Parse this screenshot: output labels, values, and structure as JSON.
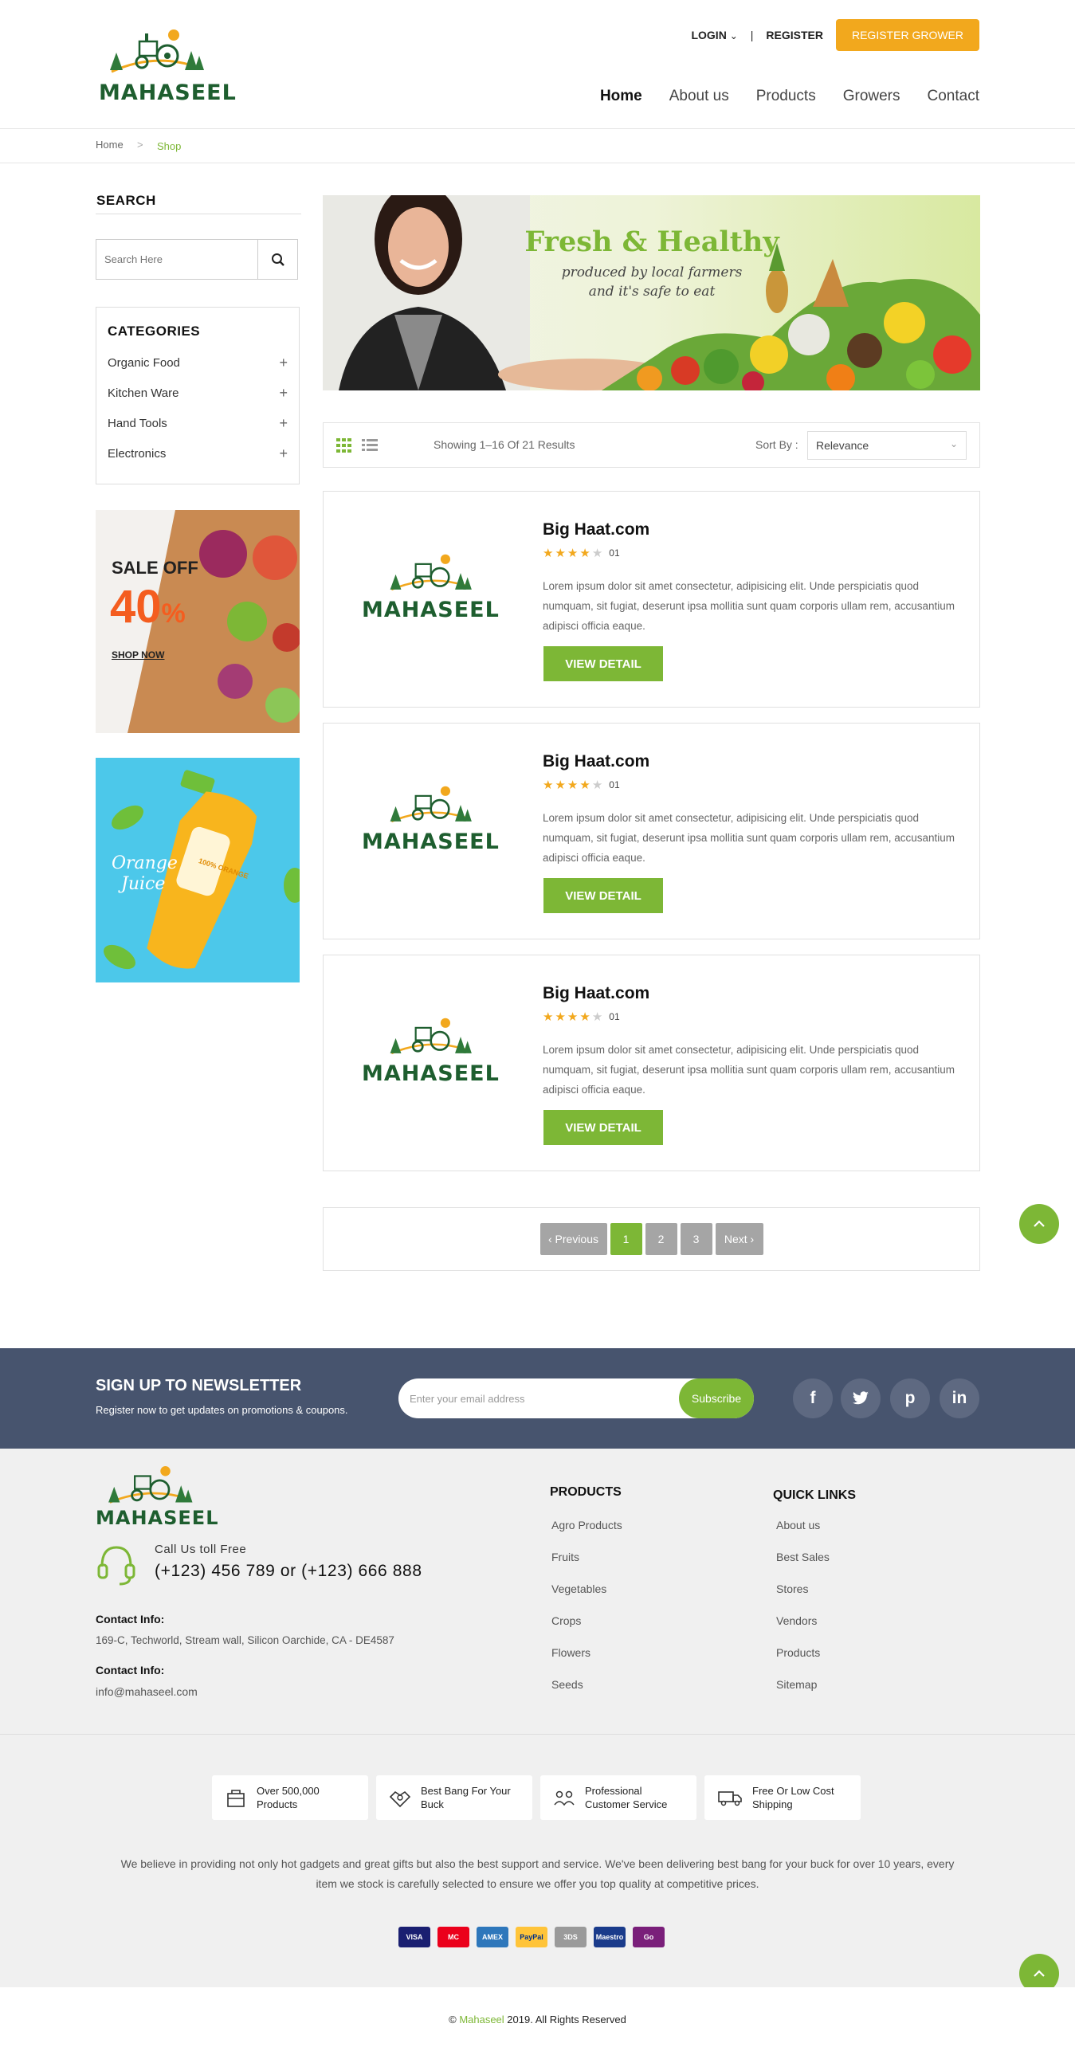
{
  "brand": {
    "name": "MAHASEEL",
    "accent": "#7db736",
    "orange": "#f2a81d",
    "dark_green": "#1e5e2f"
  },
  "header": {
    "login": "LOGIN",
    "separator": "|",
    "register": "REGISTER",
    "register_grower": "REGISTER GROWER",
    "nav": [
      "Home",
      "About us",
      "Products",
      "Growers",
      "Contact"
    ]
  },
  "breadcrumb": {
    "home": "Home",
    "sep": ">",
    "current": "Shop"
  },
  "sidebar": {
    "search_title": "SEARCH",
    "search_placeholder": "Search Here",
    "categories_title": "CATEGORIES",
    "categories": [
      {
        "label": "Organic Food",
        "icon": "+"
      },
      {
        "label": "Kitchen Ware",
        "icon": "+"
      },
      {
        "label": "Hand Tools",
        "icon": "+"
      },
      {
        "label": "Electronics",
        "icon": "+"
      }
    ],
    "sale_banner": {
      "line1": "SALE OFF",
      "percent": "40",
      "pct_sign": "%",
      "cta": "SHOP NOW"
    },
    "juice_banner": {
      "line1": "Orange",
      "line2": "Juice",
      "label": "100% ORANGE"
    }
  },
  "hero": {
    "title": "Fresh & Healthy",
    "sub1": "produced by local farmers",
    "sub2": "and it's safe to eat"
  },
  "toolbar": {
    "results": "Showing 1–16 Of 21 Results",
    "sort_label": "Sort By :",
    "sort_value": "Relevance"
  },
  "listings": [
    {
      "title": "Big Haat.com",
      "rating": 4,
      "rating_count": "01",
      "desc": "Lorem ipsum dolor sit amet consectetur, adipisicing elit. Unde perspiciatis quod numquam, sit fugiat, deserunt ipsa mollitia sunt quam corporis ullam rem, accusantium adipisci officia eaque.",
      "button": "VIEW DETAIL"
    },
    {
      "title": "Big Haat.com",
      "rating": 4,
      "rating_count": "01",
      "desc": "Lorem ipsum dolor sit amet consectetur, adipisicing elit. Unde perspiciatis quod numquam, sit fugiat, deserunt ipsa mollitia sunt quam corporis ullam rem, accusantium adipisci officia eaque.",
      "button": "VIEW DETAIL"
    },
    {
      "title": "Big Haat.com",
      "rating": 4,
      "rating_count": "01",
      "desc": "Lorem ipsum dolor sit amet consectetur, adipisicing elit. Unde perspiciatis quod numquam, sit fugiat, deserunt ipsa mollitia sunt quam corporis ullam rem, accusantium adipisci officia eaque.",
      "button": "VIEW DETAIL"
    }
  ],
  "pagination": {
    "prev": "‹ Previous",
    "pages": [
      "1",
      "2",
      "3"
    ],
    "current": "1",
    "next": "Next ›"
  },
  "newsletter": {
    "title": "SIGN UP TO NEWSLETTER",
    "subtitle": "Register now to get updates on promotions & coupons.",
    "placeholder": "Enter your email address",
    "button": "Subscribe",
    "social": [
      {
        "name": "facebook-icon",
        "glyph": "f"
      },
      {
        "name": "twitter-icon",
        "glyph": "t"
      },
      {
        "name": "pinterest-icon",
        "glyph": "p"
      },
      {
        "name": "linkedin-icon",
        "glyph": "in"
      }
    ]
  },
  "footer": {
    "call_label": "Call Us toll Free",
    "phone": "(+123) 456 789 or (+123) 666 888",
    "contact1_label": "Contact Info:",
    "address": "169-C, Techworld, Stream wall, Silicon Oarchide, CA - DE4587",
    "contact2_label": "Contact Info:",
    "email": "info@mahaseel.com",
    "products_title": "PRODUCTS",
    "products": [
      "Agro Products",
      "Fruits",
      "Vegetables",
      "Crops",
      "Flowers",
      "Seeds"
    ],
    "quick_title": "QUICK LINKS",
    "quick": [
      "About us",
      "Best Sales",
      "Stores",
      "Vendors",
      "Products",
      "Sitemap"
    ],
    "features": [
      {
        "l1": "Over 500,000",
        "l2": "Products"
      },
      {
        "l1": "Best Bang For Your",
        "l2": "Buck"
      },
      {
        "l1": "Professional",
        "l2": "Customer Service"
      },
      {
        "l1": "Free Or Low Cost",
        "l2": "Shipping"
      }
    ],
    "about_line1": "We believe in providing not only hot gadgets and great gifts but also the best support and service. We've been delivering best bang for your buck for over 10 years, every",
    "about_line2": "item we stock is carefully selected to ensure we offer you top quality at competitive prices.",
    "payments": [
      {
        "name": "visa-icon",
        "text": "VISA",
        "color": "#1a1f71"
      },
      {
        "name": "mastercard-icon",
        "text": "MC",
        "color": "#eb001b"
      },
      {
        "name": "amex-icon",
        "text": "AMEX",
        "color": "#2e77bb"
      },
      {
        "name": "paypal-icon",
        "text": "PayPal",
        "color": "#ffc439"
      },
      {
        "name": "3dsecure-icon",
        "text": "3DS",
        "color": "#9a9a9a"
      },
      {
        "name": "maestro-icon",
        "text": "Maestro",
        "color": "#1a3b8b"
      },
      {
        "name": "discover-icon",
        "text": "Go",
        "color": "#7a1f7a"
      }
    ],
    "copyright_pre": "© ",
    "copyright_brand": "Mahaseel",
    "copyright_post": " 2019. All Rights Reserved"
  }
}
